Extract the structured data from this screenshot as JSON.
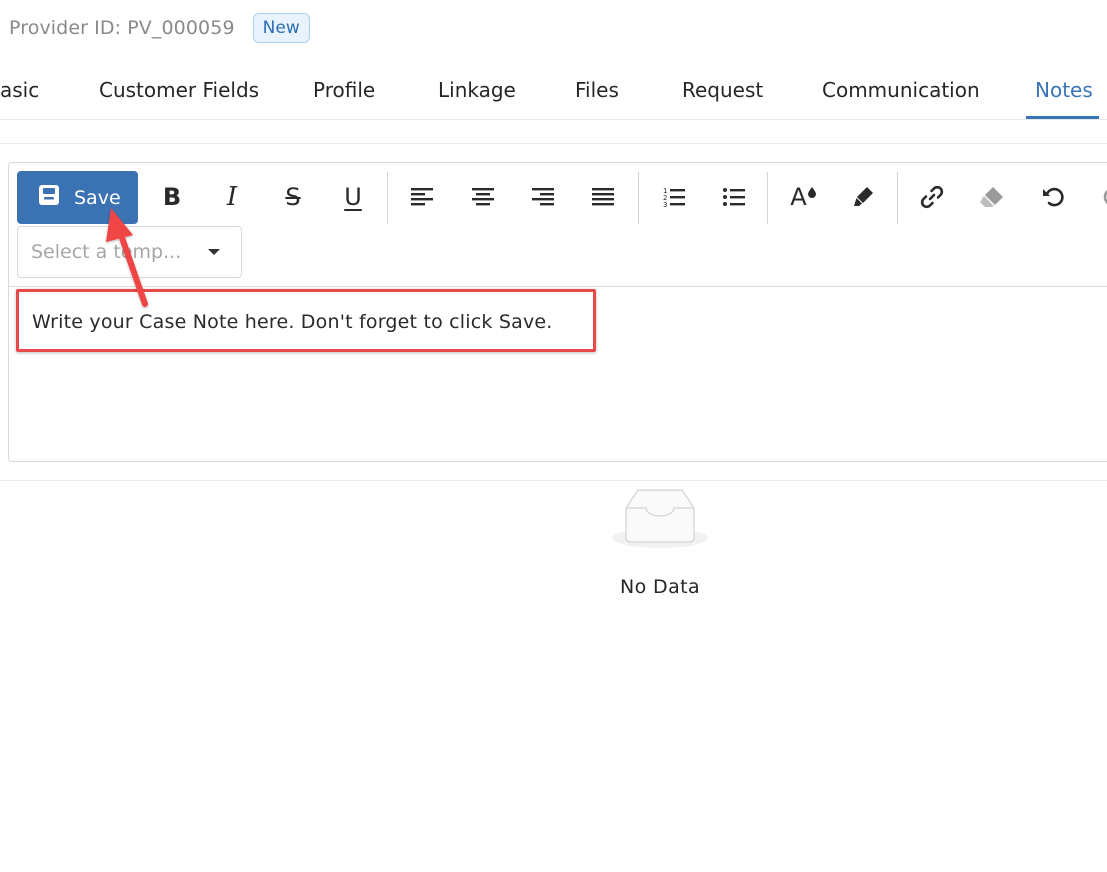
{
  "header": {
    "provider_id": "Provider ID: PV_000059",
    "status_badge": "New"
  },
  "tabs": [
    {
      "label": "asic"
    },
    {
      "label": "Customer Fields"
    },
    {
      "label": "Profile"
    },
    {
      "label": "Linkage"
    },
    {
      "label": "Files"
    },
    {
      "label": "Request"
    },
    {
      "label": "Communication"
    },
    {
      "label": "Notes",
      "active": true
    }
  ],
  "toolbar": {
    "save_label": "Save",
    "bold": "B",
    "italic": "I",
    "strike": "S",
    "underline": "U",
    "font_color": "A",
    "template_placeholder": "Select a temp..."
  },
  "editor": {
    "note_text": "Write your Case Note here. Don't forget to click Save."
  },
  "empty_state": {
    "text": "No Data"
  },
  "colors": {
    "accent": "#3a74b8",
    "save_button": "#3a72b3",
    "annotation": "#e74848"
  }
}
